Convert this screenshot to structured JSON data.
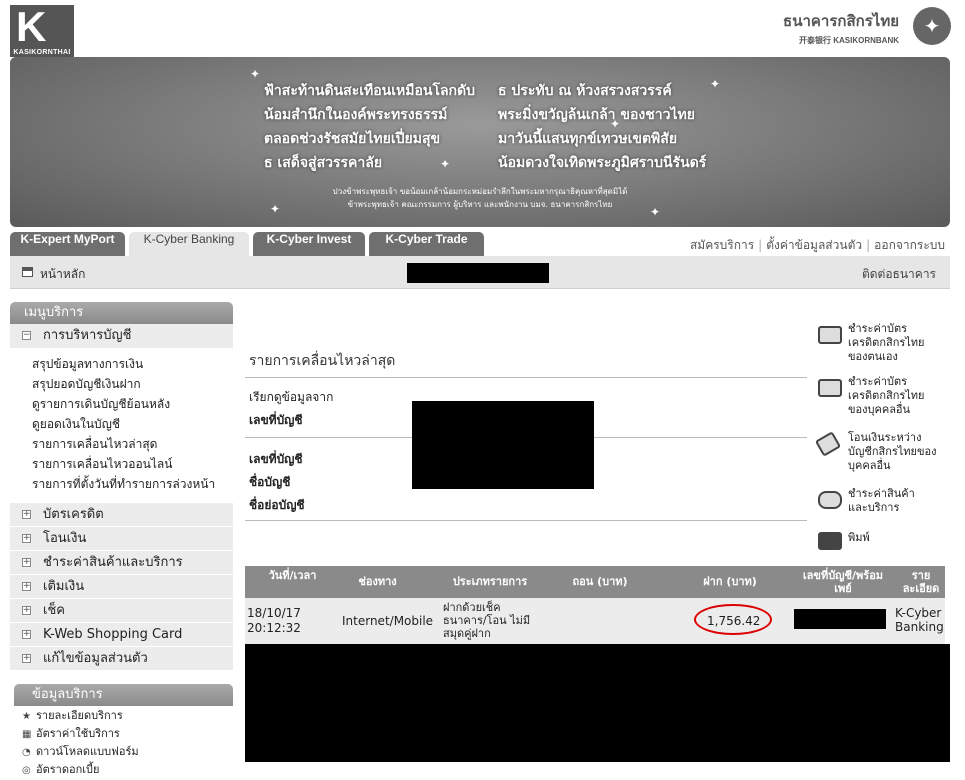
{
  "header": {
    "logo_left_text": "KASIKORNTHAI",
    "bank_name_th": "ธนาคารกสิกรไทย",
    "bank_name_en": "开泰银行 KASIKORNBANK"
  },
  "banner": {
    "poem_left": [
      "ฟ้าสะท้านดินสะเทือนเหมือนโลกดับ",
      "น้อมสำนึกในองค์พระทรงธรรม์",
      "ตลอดช่วงรัชสมัยไทยเปี่ยมสุข",
      "ธ เสด็จสู่สวรรคาลัย"
    ],
    "poem_right": [
      "ธ ประทับ ณ ห้วงสรวงสวรรค์",
      "พระมิ่งขวัญล้นเกล้า ของชาวไทย",
      "มาวันนี้แสนทุกข์เทวษเขตพิสัย",
      "น้อมดวงใจเทิดพระภูมิศราบนีรันดร์"
    ],
    "caption_1": "ปวงข้าพระพุทธเจ้า ขอน้อมเกล้าน้อมกระหม่อมรำลึกในพระมหากรุณาธิคุณหาที่สุดมิได้",
    "caption_2": "ข้าพระพุทธเจ้า คณะกรรมการ ผู้บริหาร และพนักงาน บมจ. ธนาคารกสิกรไทย"
  },
  "tabs": [
    "K-Expert MyPort",
    "K-Cyber Banking",
    "K-Cyber Invest",
    "K-Cyber Trade"
  ],
  "top_links": [
    "สมัครบริการ",
    "ตั้งค่าข้อมูลส่วนตัว",
    "ออกจากระบบ"
  ],
  "home_bar": {
    "home": "หน้าหลัก",
    "contact": "ติดต่อธนาคาร"
  },
  "sidebar": {
    "menu_title": "เมนูบริการ",
    "account_mgmt": "การบริหารบัญชี",
    "account_items": [
      "สรุปข้อมูลทางการเงิน",
      "สรุปยอดบัญชีเงินฝาก",
      "ดูรายการเดินบัญชีย้อนหลัง",
      "ดูยอดเงินในบัญชี",
      "รายการเคลื่อนไหวล่าสุด",
      "รายการเคลื่อนไหวออนไลน์",
      "รายการที่ตั้งวันที่ทำรายการล่วงหน้า"
    ],
    "categories": [
      "บัตรเครดิต",
      "โอนเงิน",
      "ชำระค่าสินค้าและบริการ",
      "เติมเงิน",
      "เช็ค",
      "K-Web Shopping Card",
      "แก้ไขข้อมูลส่วนตัว"
    ],
    "service_info_title": "ข้อมูลบริการ",
    "service_info_items": [
      "รายละเอียดบริการ",
      "อัตราค่าใช้บริการ",
      "ดาวน์โหลดแบบฟอร์ม",
      "อัตราดอกเบี้ย"
    ]
  },
  "main": {
    "title": "รายการเคลื่อนไหวล่าสุด",
    "query_from": "เรียกดูข้อมูลจาก",
    "account_no": "เลขที่บัญชี",
    "account_no2": "เลขที่บัญชี",
    "account_name": "ชื่อบัญชี",
    "account_short": "ชื่อย่อบัญชี"
  },
  "quick_actions": [
    {
      "label": "ชำระค่าบัตรเครดิตกสิกรไทยของตนเอง",
      "icon": "credit-card-icon"
    },
    {
      "label": "ชำระค่าบัตรเครดิตกสิกรไทยของบุคคลอื่น",
      "icon": "credit-card-icon"
    },
    {
      "label": "โอนเงินระหว่างบัญชีกสิกรไทยของบุคคลอื่น",
      "icon": "transfer-icon"
    },
    {
      "label": "ชำระค่าสินค้าและบริการ",
      "icon": "payment-hand-icon"
    },
    {
      "label": "พิมพ์",
      "icon": "printer-icon"
    }
  ],
  "table": {
    "headers": [
      "วันที่/เวลา",
      "ช่องทาง",
      "ประเภทรายการ",
      "ถอน (บาท)",
      "ฝาก (บาท)",
      "เลขที่บัญชี/พร้อมเพย์",
      "รายละเอียด"
    ],
    "row": {
      "date": "18/10/17",
      "time": "20:12:32",
      "channel": "Internet/Mobile",
      "type": "ฝากด้วยเช็คธนาคาร/โอน ไม่มีสมุดคู่ฝาก",
      "withdraw": "",
      "deposit": "1,756.42",
      "detail": "K-Cyber Banking"
    }
  }
}
